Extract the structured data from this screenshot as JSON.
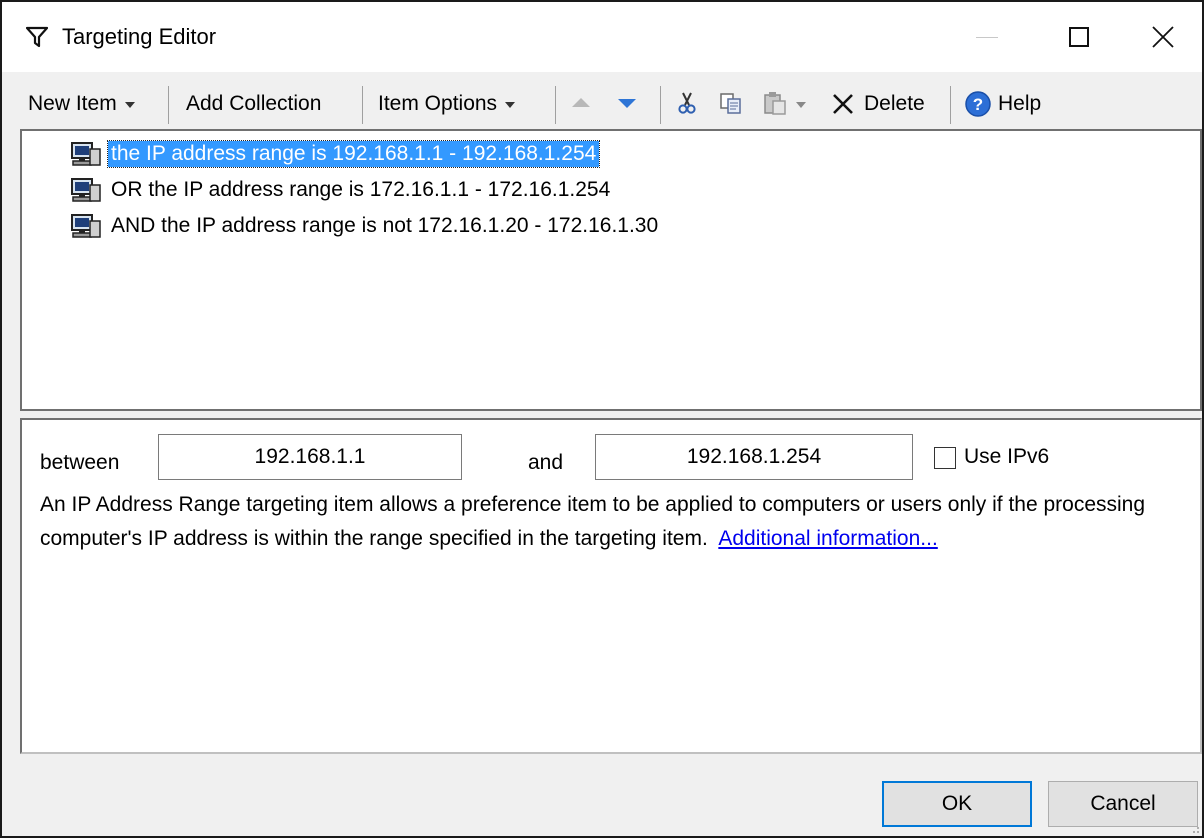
{
  "window": {
    "title": "Targeting Editor",
    "title_icon": "filter-icon",
    "minimize_icon": "minimize-icon",
    "maximize_icon": "maximize-icon",
    "close_icon": "close-icon"
  },
  "toolbar": {
    "new_item": "New Item",
    "add_collection": "Add Collection",
    "item_options": "Item Options",
    "move_up_icon": "arrow-up-icon",
    "move_down_icon": "arrow-down-icon",
    "cut_icon": "scissors-icon",
    "copy_icon": "copy-icon",
    "paste_icon": "paste-icon",
    "delete": "Delete",
    "delete_icon": "x-icon",
    "help": "Help",
    "help_icon": "help-circle-icon"
  },
  "tree": {
    "items": [
      {
        "label": "the IP address range is 192.168.1.1 - 192.168.1.254",
        "selected": true,
        "icon": "computer-icon"
      },
      {
        "label": "OR the IP address range is 172.16.1.1 - 172.16.1.254",
        "selected": false,
        "icon": "computer-icon"
      },
      {
        "label": "AND the IP address range is not 172.16.1.20 - 172.16.1.30",
        "selected": false,
        "icon": "computer-icon"
      }
    ]
  },
  "detail": {
    "between_label": "between",
    "start_ip": "192.168.1.1",
    "and_label": "and",
    "end_ip": "192.168.1.254",
    "ipv6_label": "Use IPv6",
    "ipv6_checked": false,
    "description": "An IP Address Range targeting item allows a preference item to be applied to computers or users only if the processing computer's IP address is within the range specified in the targeting item.",
    "link_text": "Additional information..."
  },
  "buttons": {
    "ok": "OK",
    "cancel": "Cancel"
  },
  "colors": {
    "selection": "#3399ff",
    "link": "#0000ee",
    "accent": "#0078d7"
  }
}
